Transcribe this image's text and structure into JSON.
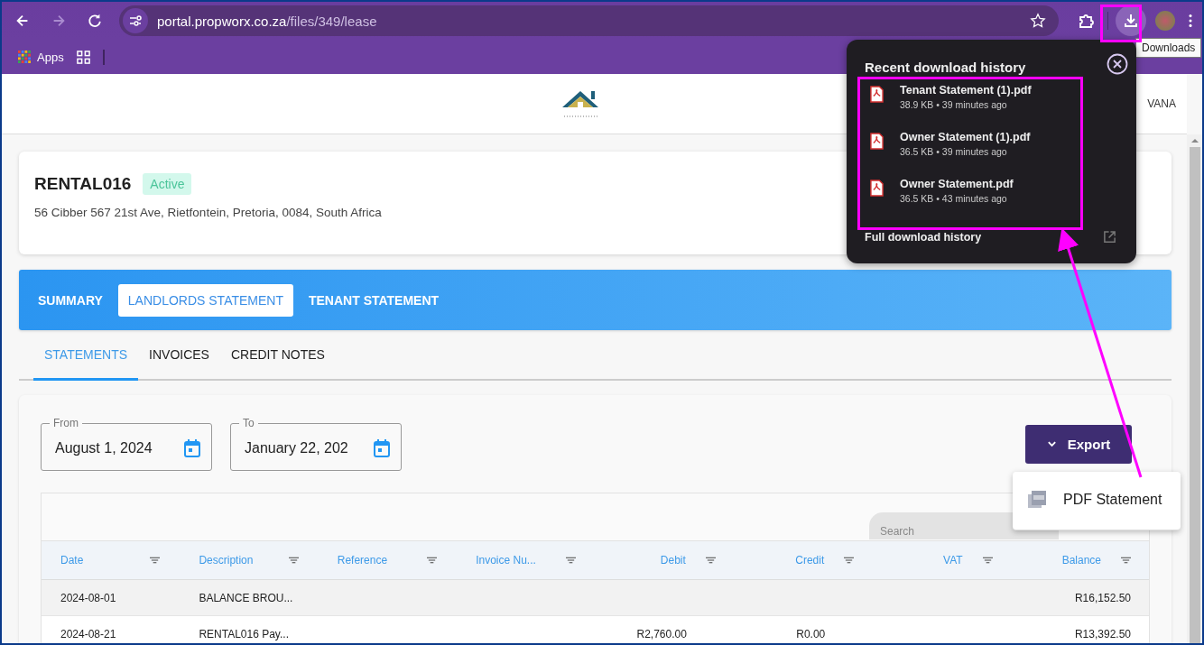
{
  "browser": {
    "url_host": "portal.propworx.co.za",
    "url_path": "/files/349/lease",
    "bookmarks": [
      {
        "label": "Apps"
      }
    ],
    "tooltip": "Downloads"
  },
  "header": {
    "user_name": "VANA"
  },
  "property": {
    "code": "RENTAL016",
    "status": "Active",
    "address": "56 Cibber 567 21st Ave, Rietfontein, Pretoria, 0084, South Africa"
  },
  "main_tabs": [
    {
      "label": "SUMMARY",
      "selected": false
    },
    {
      "label": "LANDLORDS STATEMENT",
      "selected": true
    },
    {
      "label": "TENANT STATEMENT",
      "selected": false
    }
  ],
  "sub_tabs": [
    {
      "label": "STATEMENTS",
      "selected": true
    },
    {
      "label": "INVOICES",
      "selected": false
    },
    {
      "label": "CREDIT NOTES",
      "selected": false
    }
  ],
  "filters": [
    {
      "label": "From",
      "value": "August 1, 2024"
    },
    {
      "label": "To",
      "value": "January 22, 202"
    }
  ],
  "export_button": {
    "label": "Export"
  },
  "export_menu": [
    {
      "label": "PDF Statement"
    }
  ],
  "table": {
    "search_placeholder": "Search",
    "columns": [
      {
        "label": "Date",
        "kind": "text"
      },
      {
        "label": "Description",
        "kind": "text"
      },
      {
        "label": "Reference",
        "kind": "text"
      },
      {
        "label": "Invoice Nu...",
        "kind": "text"
      },
      {
        "label": "Debit",
        "kind": "amount"
      },
      {
        "label": "Credit",
        "kind": "amount"
      },
      {
        "label": "VAT",
        "kind": "amount"
      },
      {
        "label": "Balance",
        "kind": "amount"
      }
    ],
    "rows": [
      {
        "cells": [
          "2024-08-01",
          "BALANCE BROU...",
          "",
          "",
          "",
          "",
          "",
          "R16,152.50"
        ]
      },
      {
        "cells": [
          "2024-08-21",
          "RENTAL016 Pay...",
          "",
          "",
          "R2,760.00",
          "R0.00",
          "",
          "R13,392.50"
        ]
      }
    ]
  },
  "downloads": {
    "title": "Recent download history",
    "items": [
      {
        "name": "Tenant Statement (1).pdf",
        "meta": "38.9 KB • 39 minutes ago"
      },
      {
        "name": "Owner Statement (1).pdf",
        "meta": "36.5 KB • 39 minutes ago"
      },
      {
        "name": "Owner Statement.pdf",
        "meta": "36.5 KB • 43 minutes ago"
      }
    ],
    "footer": "Full download history"
  }
}
